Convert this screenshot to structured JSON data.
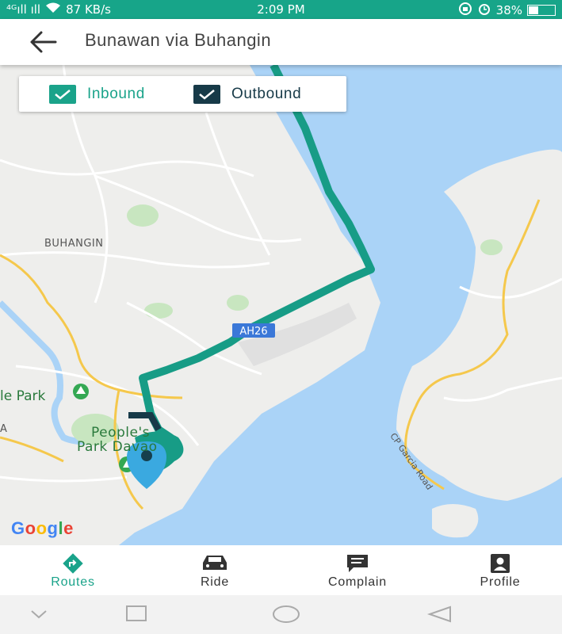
{
  "status_bar": {
    "signal": "⁴ᴳıll ıll",
    "speed": "87 KB/s",
    "time": "2:09 PM",
    "battery": "38%",
    "battery_level": 0.38
  },
  "header": {
    "title": "Bunawan via Buhangin"
  },
  "legend": {
    "inbound_label": "Inbound",
    "outbound_label": "Outbound",
    "inbound_checked": true,
    "outbound_checked": true,
    "inbound_color": "#1aa38a",
    "outbound_color": "#173a48"
  },
  "map": {
    "labels": {
      "buhangin": "BUHANGIN",
      "ah26": "AH26",
      "park_left": "le Park",
      "peoples_park_line1": "People's",
      "peoples_park_line2": "Park Davao",
      "left_edge": "A",
      "road": "CP Garcia Road"
    },
    "google": "Google",
    "colors": {
      "water": "#aad3f7",
      "land": "#eeeeec",
      "route": "#179c86",
      "road_major": "#f8d27a"
    }
  },
  "bottom_nav": {
    "items": [
      {
        "label": "Routes",
        "icon": "directions-icon",
        "active": true
      },
      {
        "label": "Ride",
        "icon": "car-icon",
        "active": false
      },
      {
        "label": "Complain",
        "icon": "message-icon",
        "active": false
      },
      {
        "label": "Profile",
        "icon": "profile-icon",
        "active": false
      }
    ],
    "active_color": "#1aa38a",
    "inactive_color": "#333333"
  }
}
